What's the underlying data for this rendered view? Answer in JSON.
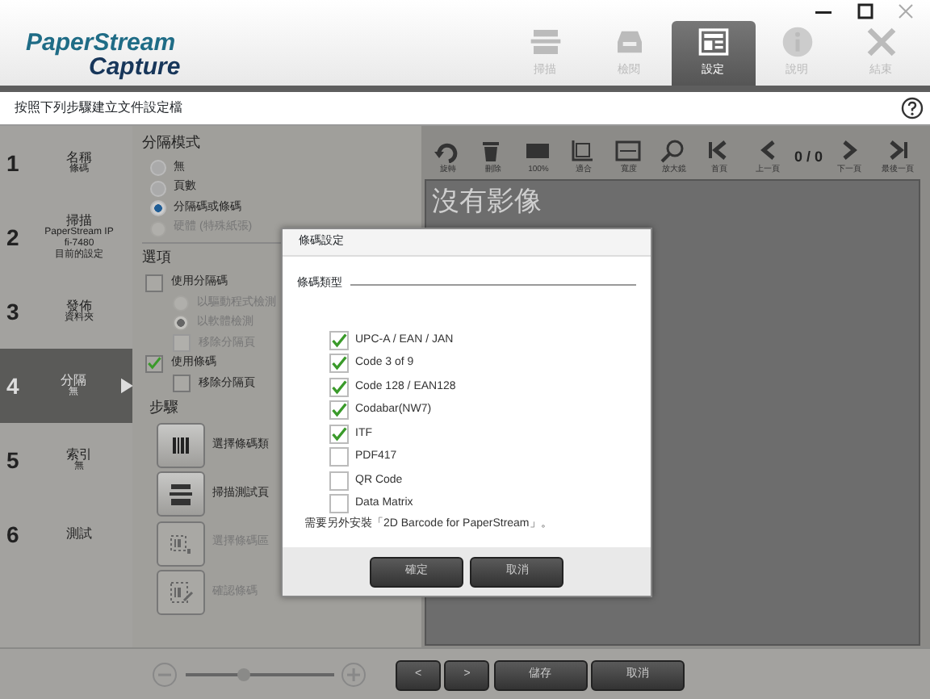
{
  "app": {
    "logo_line1": "PaperStream",
    "logo_line2": "Capture"
  },
  "toolbar": [
    {
      "label": "掃描",
      "selected": false
    },
    {
      "label": "檢閱",
      "selected": false
    },
    {
      "label": "設定",
      "selected": true
    },
    {
      "label": "說明",
      "selected": false
    },
    {
      "label": "結束",
      "selected": false
    }
  ],
  "instruction": "按照下列步驟建立文件設定檔",
  "steps": [
    {
      "number": "1",
      "title": "名稱",
      "details": [
        "條碼"
      ],
      "selected": false
    },
    {
      "number": "2",
      "title": "掃描",
      "details": [
        "PaperStream IP",
        "fi-7480",
        "目前的設定"
      ],
      "selected": false
    },
    {
      "number": "3",
      "title": "發佈",
      "details": [
        "資料夾"
      ],
      "selected": false
    },
    {
      "number": "4",
      "title": "分隔",
      "details": [
        "無"
      ],
      "selected": true
    },
    {
      "number": "5",
      "title": "索引",
      "details": [
        "無"
      ],
      "selected": false
    },
    {
      "number": "6",
      "title": "測試",
      "selected": false
    }
  ],
  "split_mode": {
    "title": "分隔模式",
    "options": [
      {
        "label": "無",
        "selected": false,
        "disabled": false
      },
      {
        "label": "頁數",
        "selected": false,
        "disabled": false
      },
      {
        "label": "分隔碼或條碼",
        "selected": true,
        "disabled": false
      },
      {
        "label": "硬體 (特殊紙張)",
        "selected": false,
        "disabled": true
      }
    ]
  },
  "options": {
    "title": "選項",
    "items": [
      {
        "kind": "checkbox",
        "label": "使用分隔碼",
        "checked": false,
        "disabled": false,
        "children": [
          {
            "kind": "radio",
            "label": "以驅動程式檢測",
            "checked": false,
            "disabled": true
          },
          {
            "kind": "radio",
            "label": "以軟體檢測",
            "checked": true,
            "disabled": true
          },
          {
            "kind": "checkbox",
            "label": "移除分隔頁",
            "checked": false,
            "disabled": true
          }
        ]
      },
      {
        "kind": "checkbox",
        "label": "使用條碼",
        "checked": true,
        "disabled": false,
        "children": [
          {
            "kind": "checkbox",
            "label": "移除分隔頁",
            "checked": false,
            "disabled": false
          }
        ]
      }
    ]
  },
  "procedure": {
    "title": "步驟",
    "items": [
      {
        "label": "選擇條碼類",
        "disabled": false
      },
      {
        "label": "掃描測試頁",
        "disabled": false
      },
      {
        "label": "選擇條碼區",
        "disabled": true
      },
      {
        "label": "確認條碼",
        "disabled": true
      }
    ]
  },
  "viewer": {
    "tools": [
      {
        "label": "旋轉"
      },
      {
        "label": "刪除"
      },
      {
        "label": "100%"
      },
      {
        "label": "適合"
      },
      {
        "label": "寬度"
      },
      {
        "label": "放大鏡"
      }
    ],
    "nav": [
      {
        "kind": "button",
        "label": "首頁"
      },
      {
        "kind": "button",
        "label": "上一頁"
      },
      {
        "kind": "counter",
        "label": "0 / 0"
      },
      {
        "kind": "button",
        "label": "下一頁"
      },
      {
        "kind": "button",
        "label": "最後一頁"
      }
    ],
    "message": "沒有影像"
  },
  "bottom": {
    "zoom": {
      "level": 0.4
    },
    "buttons": [
      "<",
      ">",
      "儲存",
      "取消"
    ]
  },
  "dialog": {
    "title": "條碼設定",
    "section": "條碼類型",
    "items": [
      {
        "label": "UPC-A / EAN / JAN",
        "checked": true
      },
      {
        "label": "Code 3 of 9",
        "checked": true
      },
      {
        "label": "Code 128 / EAN128",
        "checked": true
      },
      {
        "label": "Codabar(NW7)",
        "checked": true
      },
      {
        "label": "ITF",
        "checked": true
      },
      {
        "label": "PDF417",
        "checked": false
      },
      {
        "label": "QR Code",
        "checked": false
      },
      {
        "label": "Data Matrix",
        "checked": false
      }
    ],
    "note": "需要另外安裝「2D Barcode for PaperStream」。",
    "buttons": [
      "確定",
      "取消"
    ]
  }
}
